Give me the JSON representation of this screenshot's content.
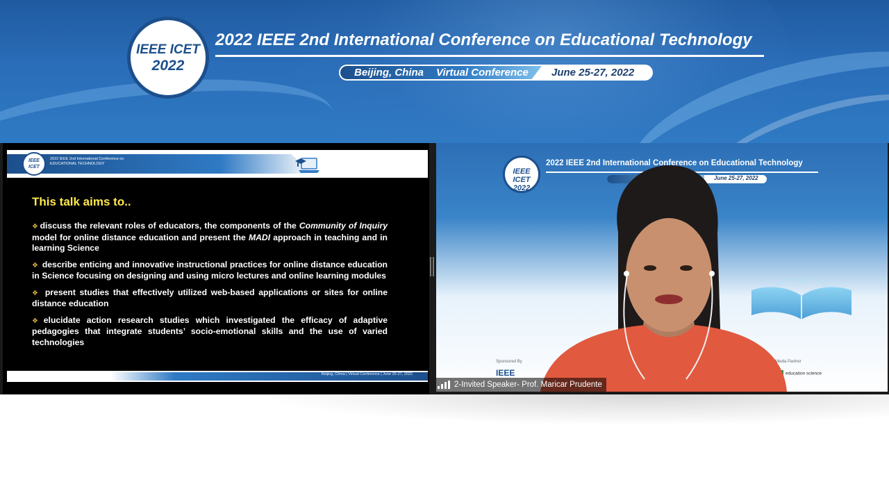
{
  "banner": {
    "logo_line1": "IEEE ICET",
    "logo_line2": "2022",
    "title": "2022 IEEE 2nd International Conference on Educational Technology",
    "location": "Beijing, China",
    "mode": "Virtual Conference",
    "dates": "June 25-27, 2022"
  },
  "slide": {
    "header_logo": "IEEE ICET",
    "header_title_line1": "2022 IEEE 2nd International Conference on",
    "header_title_line2": "EDUCATIONAL TECHNOLOGY",
    "title": "This talk aims to..",
    "bullets": {
      "b1": {
        "t1": "discuss the relevant roles of educators, the  components of the ",
        "em1": "Community of Inquiry",
        "t2": " model for online distance education and present the ",
        "em2": "MADI",
        "t3": " approach in teaching and in learning Science"
      },
      "b2": "describe enticing and innovative instructional practices for online distance education in Science focusing on designing and using micro lectures and online learning modules",
      "b3": "present studies that effectively utilized web-based applications or sites for online distance education",
      "b4": "elucidate action research studies which investigated the efficacy of adaptive pedagogies that integrate students’ socio-emotional skills and the use of varied technologies"
    },
    "bullet_mark": "❖",
    "footer_text": "Beijing, China | Virtual Conference | June 25-27, 2022"
  },
  "speaker": {
    "bg_logo_line1": "IEEE ICET",
    "bg_logo_line2": "2022",
    "bg_title": "2022 IEEE 2nd International Conference on Educational Technology",
    "bg_dates": "June 25-27, 2022",
    "sponsored_by": "Sponsored By",
    "sponsor": "IEEE",
    "media_partner": "Media Partner",
    "media_partner_name": "education science",
    "name_tag": "2-Invited Speaker- Prof. Maricar Prudente"
  },
  "colors": {
    "banner_blue": "#1f5aa0",
    "slide_title_yellow": "#ffe94a",
    "logo_navy": "#1c4f8c"
  }
}
